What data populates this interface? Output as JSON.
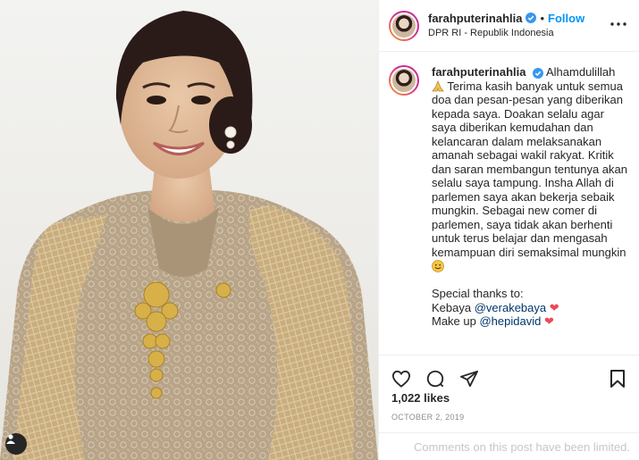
{
  "post": {
    "image_alt": "Woman in gold lace kebaya with songket shawl",
    "user_tag_icon": "user-tag-icon"
  },
  "header": {
    "username": "farahputerinahlia",
    "separator": "•",
    "follow_label": "Follow",
    "location": "DPR RI - Republik Indonesia"
  },
  "caption": {
    "username": "farahputerinahlia",
    "line_1_intro": " Alhamdulillah",
    "body": " Terima kasih banyak untuk semua doa dan pesan-pesan yang diberikan kepada saya. Doakan selalu agar saya diberikan kemudahan dan kelancaran dalam melaksanakan amanah sebagai wakil rakyat. Kritik dan saran membangun tentunya akan selalu saya tampung. Insha Allah di parlemen saya akan bekerja sebaik mungkin. Sebagai new comer di parlemen, saya tidak akan berhenti untuk terus belajar dan mengasah kemampuan diri semaksimal mungkin ",
    "thanks_heading": "Special thanks to:",
    "credit_1_label": "Kebaya ",
    "credit_1_handle": "@verakebaya",
    "credit_2_label": "Make up ",
    "credit_2_handle": "@hepidavid",
    "heart": "❤"
  },
  "engagement": {
    "likes": "1,022 likes",
    "date": "October 2, 2019",
    "comments_notice": "Comments on this post have been limited."
  },
  "colors": {
    "accent": "#0095f6",
    "verified": "#3897f0",
    "heart": "#ed4956",
    "mention": "#00376b",
    "muted": "#8e8e8e"
  }
}
